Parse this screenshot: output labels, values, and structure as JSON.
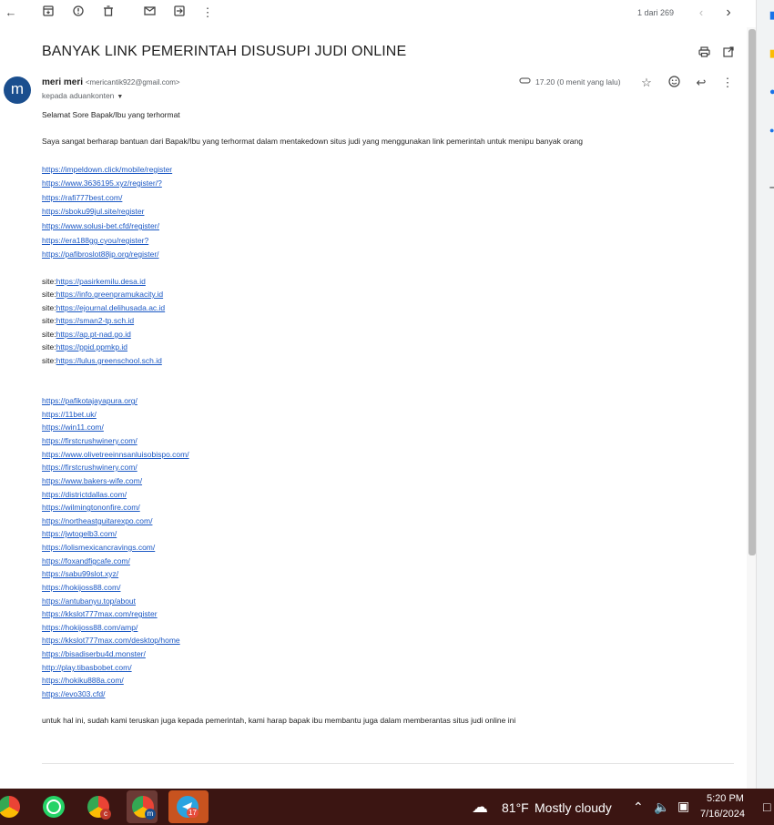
{
  "toolbar": {
    "back_icon": "arrow-left-icon",
    "pager": "1 dari 269"
  },
  "email": {
    "subject": "BANYAK LINK PEMERINTAH DISUSUPI JUDI ONLINE",
    "avatar_letter": "m",
    "sender_name": "meri meri",
    "sender_email": "<mericantik922@gmail.com>",
    "recipient": "kepada aduankonten",
    "time": "17.20 (0 menit yang lalu)",
    "greeting": "Selamat Sore Bapak/Ibu yang terhormat",
    "intro": "Saya sangat berharap bantuan dari Bapak/Ibu yang terhormat dalam mentakedown situs judi yang menggunakan link pemerintah untuk menipu banyak orang",
    "links_group1": [
      "https://impeldown.click/mobile/register",
      "https://www.3636195.xyz/register/?",
      "https://rafi777best.com/",
      "https://sboku99jul.site/register",
      "https://www.solusi-bet.cfd/register/",
      "https://era188gg.cyou/register?",
      "https://pafibroslot88jp.org/register/"
    ],
    "site_prefix": "site:",
    "site_links": [
      "https://pasirkemilu.desa.id",
      "https://info.greenpramukacity.id",
      "https://ejournal.delihusada.ac.id",
      "https://sman2-tp.sch.id",
      "https://ap.pt-nad.go.id",
      "https://ppid.ppmkp.id",
      "https://lulus.greenschool.sch.id"
    ],
    "links_group2": [
      "https://pafikotajayapura.org/",
      "https://11bet.uk/",
      "https://win11.com/",
      "https://firstcrushwinery.com/",
      "https://www.olivetreeinnsanluisobispo.com/",
      "https://firstcrushwinery.com/",
      "https://www.bakers-wife.com/",
      "https://districtdallas.com/",
      "https://wilmingtononfire.com/",
      "https://northeastguitarexpo.com/",
      "https://jwtogelb3.com/",
      "https://lolismexicancravings.com/",
      "https://foxandfigcafe.com/",
      "https://sabu99slot.xyz/",
      "https://hokijoss88.com/",
      "https://antubanyu.top/about",
      "https://kkslot777max.com/register",
      "https://hokijoss88.com/amp/",
      "https://kkslot777max.com/desktop/home",
      "https://bisadiserbu4d.monster/",
      "http://play.tibasbobet.com/",
      "https://hokiku888a.com/",
      "https://evo303.cfd/"
    ],
    "closing": "untuk hal ini, sudah kami teruskan juga kepada pemerintah, kami harap bapak ibu membantu juga dalam memberantas situs judi online ini"
  },
  "taskbar": {
    "weather_temp": "81°F",
    "weather_desc": "Mostly cloudy",
    "clock_time": "5:20 PM",
    "clock_date": "7/16/2024",
    "telegram_badge": "17",
    "chrome_badge_c": "c",
    "chrome_badge_m": "m"
  },
  "colors": {
    "link": "#1a57c4",
    "avatar": "#1a4e8e",
    "taskbar": "#3b1512"
  }
}
